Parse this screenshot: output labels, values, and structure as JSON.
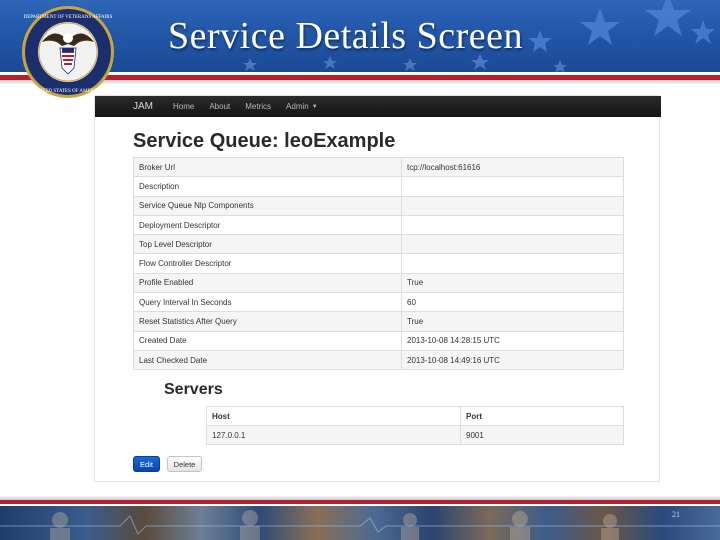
{
  "slide": {
    "title": "Service Details Screen",
    "slide_number": "21"
  },
  "colors": {
    "banner_blue": "#2257a8",
    "accent_red": "#b51f2e",
    "navbar_dark": "#1b1b1b",
    "primary_button": "#0d4fc2"
  },
  "navbar": {
    "brand": "JAM",
    "links": [
      "Home",
      "About",
      "Metrics",
      "Admin"
    ],
    "admin_dropdown_icon": "caret-down"
  },
  "service": {
    "heading": "Service Queue: leoExample",
    "rows": [
      {
        "label": "Broker Url",
        "value": "tcp://localhost:61616"
      },
      {
        "label": "Description",
        "value": ""
      },
      {
        "label": "Service Queue Nlp Components",
        "value": ""
      },
      {
        "label": "Deployment Descriptor",
        "value": ""
      },
      {
        "label": "Top Level Descriptor",
        "value": ""
      },
      {
        "label": "Flow Controller Descriptor",
        "value": ""
      },
      {
        "label": "Profile Enabled",
        "value": "True"
      },
      {
        "label": "Query Interval In Seconds",
        "value": "60"
      },
      {
        "label": "Reset Statistics After Query",
        "value": "True"
      },
      {
        "label": "Created Date",
        "value": "2013-10-08 14:28:15 UTC"
      },
      {
        "label": "Last Checked Date",
        "value": "2013-10-08 14:49:16 UTC"
      }
    ]
  },
  "servers": {
    "heading": "Servers",
    "columns": [
      "Host",
      "Port"
    ],
    "rows": [
      {
        "host": "127.0.0.1",
        "port": "9001"
      }
    ]
  },
  "actions": {
    "edit_label": "Edit",
    "delete_label": "Delete"
  }
}
